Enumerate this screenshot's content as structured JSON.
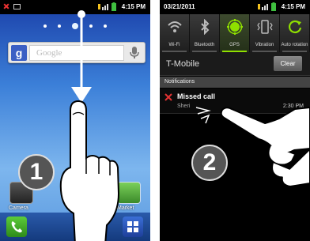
{
  "left_phone": {
    "status_time": "4:15 PM",
    "search_placeholder": "Google",
    "google_logo": "g",
    "step_number": "1",
    "icon_labels": {
      "camera": "Camera",
      "market": "Market"
    }
  },
  "right_phone": {
    "status_date": "03/21/2011",
    "status_time": "4:15 PM",
    "toggles": [
      {
        "label": "Wi-Fi",
        "icon": "wifi-icon",
        "active": false
      },
      {
        "label": "Bluetooth",
        "icon": "bluetooth-icon",
        "active": false
      },
      {
        "label": "GPS",
        "icon": "gps-icon",
        "active": true
      },
      {
        "label": "Vibration",
        "icon": "vibration-icon",
        "active": false
      },
      {
        "label": "Auto rotation",
        "icon": "rotation-icon",
        "active": false
      }
    ],
    "carrier": "T-Mobile",
    "clear_label": "Clear",
    "notifications_header": "Notifications",
    "notification": {
      "title": "Missed call",
      "subtitle": "Sheri",
      "time": "2:30 PM"
    },
    "step_number": "2"
  },
  "colors": {
    "wallpaper_top": "#1a3fa8",
    "wallpaper_mid": "#7db6ee",
    "gps_active": "#8fe000",
    "missed_call_red": "#e33333"
  }
}
